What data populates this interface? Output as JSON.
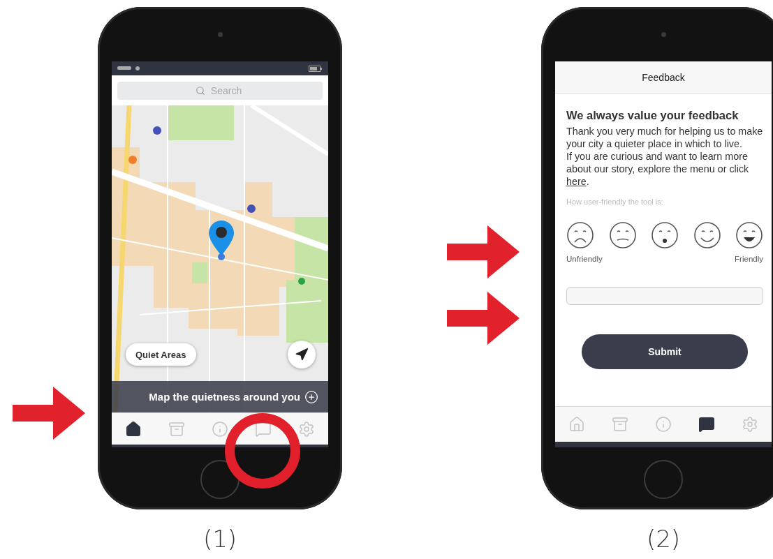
{
  "phone_1": {
    "search": {
      "placeholder": "Search"
    },
    "quiet_areas_button": "Quiet Areas",
    "banner": "Map the quietness around you",
    "tabs": [
      {
        "kind": "home",
        "selected": true
      },
      {
        "kind": "archive",
        "selected": false
      },
      {
        "kind": "info",
        "selected": false
      },
      {
        "kind": "feedback",
        "selected": false
      },
      {
        "kind": "settings",
        "selected": false
      }
    ],
    "caption": "(1)"
  },
  "phone_2": {
    "header": "Feedback",
    "heading": "We always value your feedback",
    "paragraph_1": "Thank you very much for helping us to make your city a quieter place in which to live.",
    "paragraph_2": {
      "before": "If you are curious and want to learn more about our story, explore the menu or click",
      "link": "here",
      "after": "."
    },
    "rating_label": "How user-friendly the tool is:",
    "scale_low": "Unfriendly",
    "scale_high": "Friendly",
    "submit": "Submit",
    "tabs": [
      {
        "kind": "home",
        "selected": false
      },
      {
        "kind": "archive",
        "selected": false
      },
      {
        "kind": "info",
        "selected": false
      },
      {
        "kind": "feedback",
        "selected": true
      },
      {
        "kind": "settings",
        "selected": false
      }
    ],
    "caption": "(2)"
  }
}
